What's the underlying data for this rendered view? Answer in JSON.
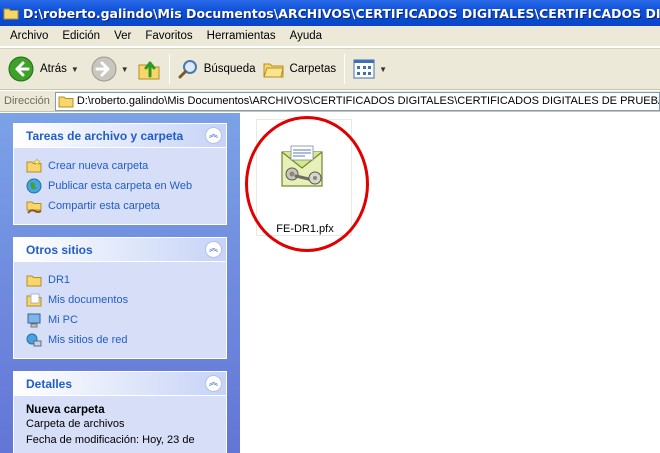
{
  "window": {
    "title": "D:\\roberto.galindo\\Mis Documentos\\ARCHIVOS\\CERTIFICADOS DIGITALES\\CERTIFICADOS DIGITALES DE PR"
  },
  "menu": [
    "Archivo",
    "Edición",
    "Ver",
    "Favoritos",
    "Herramientas",
    "Ayuda"
  ],
  "toolbar": {
    "back_label": "Atrás",
    "search_label": "Búsqueda",
    "folders_label": "Carpetas"
  },
  "address": {
    "label": "Dirección",
    "path": "D:\\roberto.galindo\\Mis Documentos\\ARCHIVOS\\CERTIFICADOS DIGITALES\\CERTIFICADOS DIGITALES DE PRUEBA\\DR1\\N"
  },
  "tasks_panel": {
    "title": "Tareas de archivo y carpeta",
    "items": [
      "Crear nueva carpeta",
      "Publicar esta carpeta en Web",
      "Compartir esta carpeta"
    ]
  },
  "places_panel": {
    "title": "Otros sitios",
    "items": [
      "DR1",
      "Mis documentos",
      "Mi PC",
      "Mis sitios de red"
    ]
  },
  "details_panel": {
    "title": "Detalles",
    "name": "Nueva carpeta",
    "type": "Carpeta de archivos",
    "modified": "Fecha de modificación: Hoy, 23 de"
  },
  "files": [
    {
      "name": "FE-DR1.pfx",
      "icon": "certificate-pfx-icon"
    }
  ],
  "colors": {
    "titlebar": "#0b4fd8",
    "link": "#215dc6",
    "highlight": "#e00000"
  }
}
